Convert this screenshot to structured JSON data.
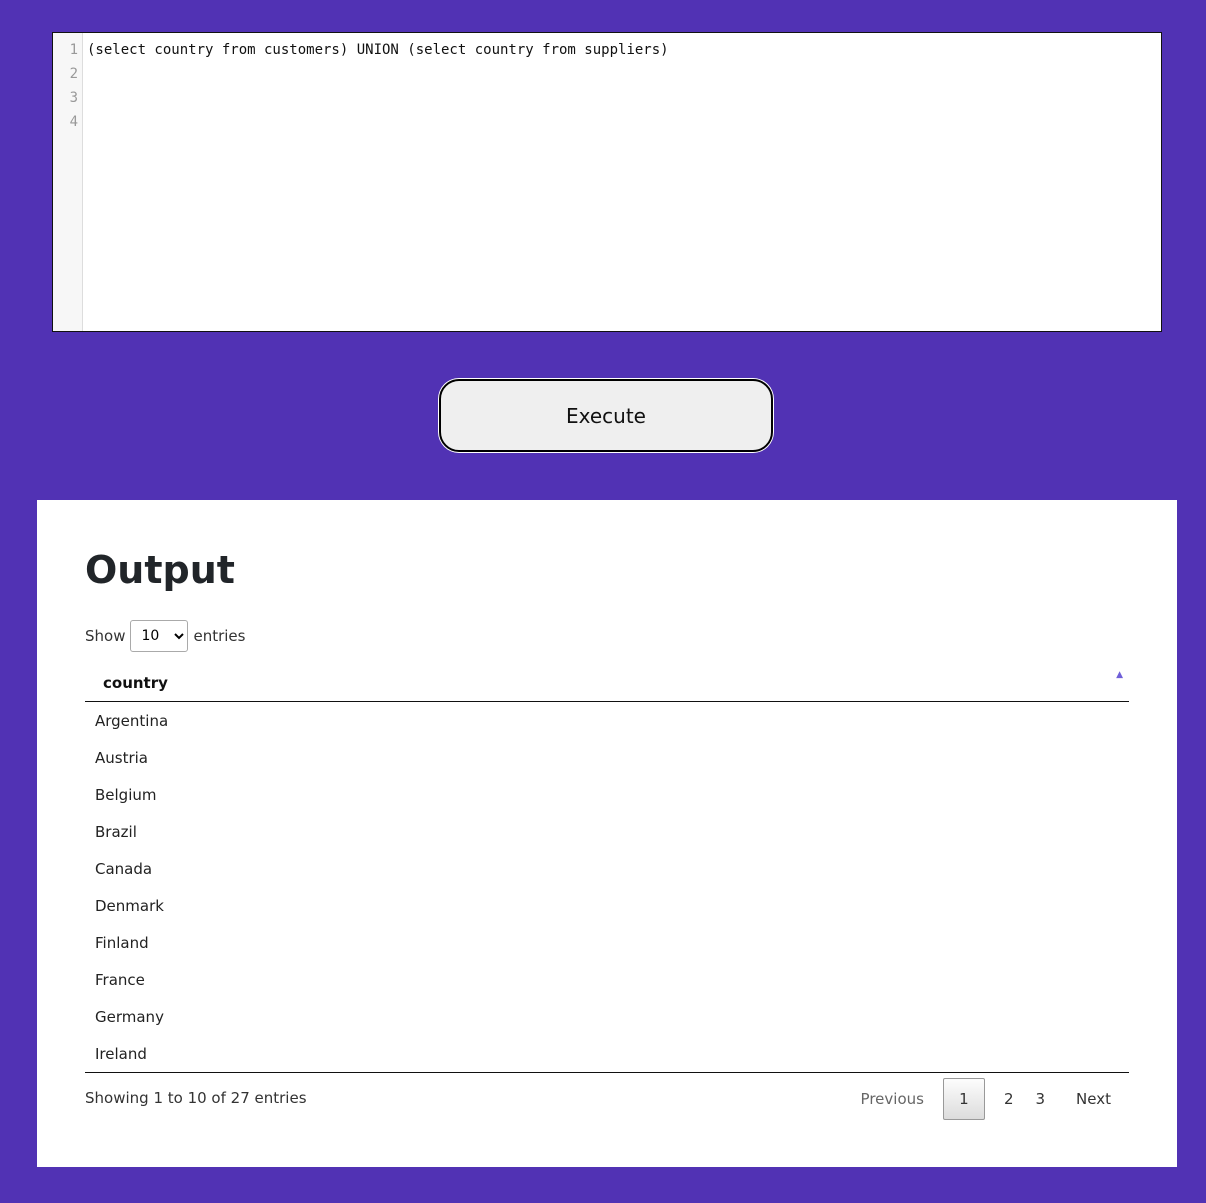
{
  "editor": {
    "line_numbers": [
      "1",
      "2",
      "3",
      "4"
    ],
    "lines": [
      "(select country from customers) UNION (select country from suppliers)",
      "",
      "",
      ""
    ]
  },
  "execute_label": "Execute",
  "output": {
    "title": "Output",
    "length": {
      "show_label": "Show",
      "selected": "10",
      "entries_label": "entries"
    },
    "column_header": "country",
    "rows": [
      "Argentina",
      "Austria",
      "Belgium",
      "Brazil",
      "Canada",
      "Denmark",
      "Finland",
      "France",
      "Germany",
      "Ireland"
    ],
    "info": "Showing 1 to 10 of 27 entries",
    "pager": {
      "previous": "Previous",
      "pages": [
        "1",
        "2",
        "3"
      ],
      "next": "Next"
    }
  },
  "colors": {
    "background": "#5132b4",
    "sort_icon": "#6f5fd8"
  },
  "icons": {
    "sort": "sort-asc-icon"
  }
}
